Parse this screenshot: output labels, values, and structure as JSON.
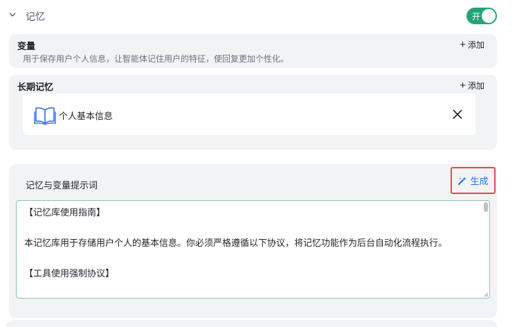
{
  "section": {
    "title": "记忆",
    "toggle_label": "开",
    "toggle_on": true
  },
  "variables": {
    "title": "变量",
    "description": "用于保存用户个人信息，让智能体记住用户的特征，使回复更加个性化。",
    "add_label": "添加"
  },
  "long_term_memory": {
    "title": "长期记忆",
    "add_label": "添加",
    "items": [
      {
        "label": "个人基本信息",
        "icon": "book-icon"
      }
    ]
  },
  "prompt": {
    "title": "记忆与变量提示词",
    "generate_label": "生成",
    "lines": [
      "【记忆库使用指南】",
      "",
      "本记忆库用于存储用户个人的基本信息。你必须严格遵循以下协议，将记忆功能作为后台自动化流程执行。",
      "",
      "【工具使用强制协议】"
    ]
  },
  "colors": {
    "toggle_on": "#24a37a",
    "accent_blue": "#2f6fed",
    "highlight_red": "#e5484d",
    "card_bg": "#f2f3f5"
  }
}
